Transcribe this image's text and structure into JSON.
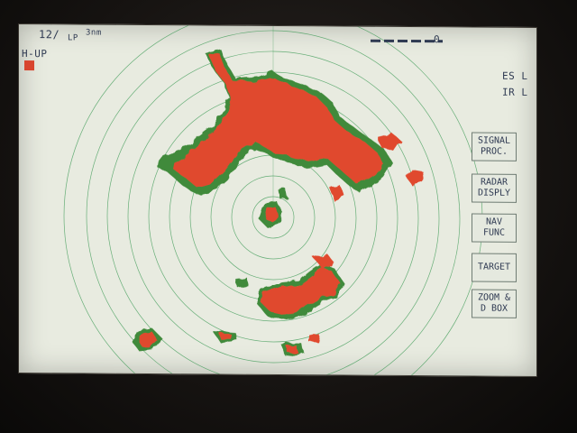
{
  "display": {
    "range": "12/",
    "pulse": "LP",
    "distance": "3nm",
    "orientation": "H-UP",
    "vrm_value": "0",
    "status_es": "ES L",
    "status_ir": "IR L"
  },
  "menu": [
    {
      "line1": "SIGNAL",
      "line2": "PROC."
    },
    {
      "line1": "RADAR",
      "line2": "DISPLY"
    },
    {
      "line1": "NAV",
      "line2": "FUNC"
    },
    {
      "line1": "TARGET",
      "line2": ""
    },
    {
      "line1": "ZOOM &",
      "line2": "D BOX"
    }
  ],
  "colors": {
    "screen_bg": "#e8ebe0",
    "ring": "#3c9a55",
    "echo_strong": "#e04a2e",
    "echo_weak": "#3f8a3b",
    "text": "#2f3a52"
  }
}
